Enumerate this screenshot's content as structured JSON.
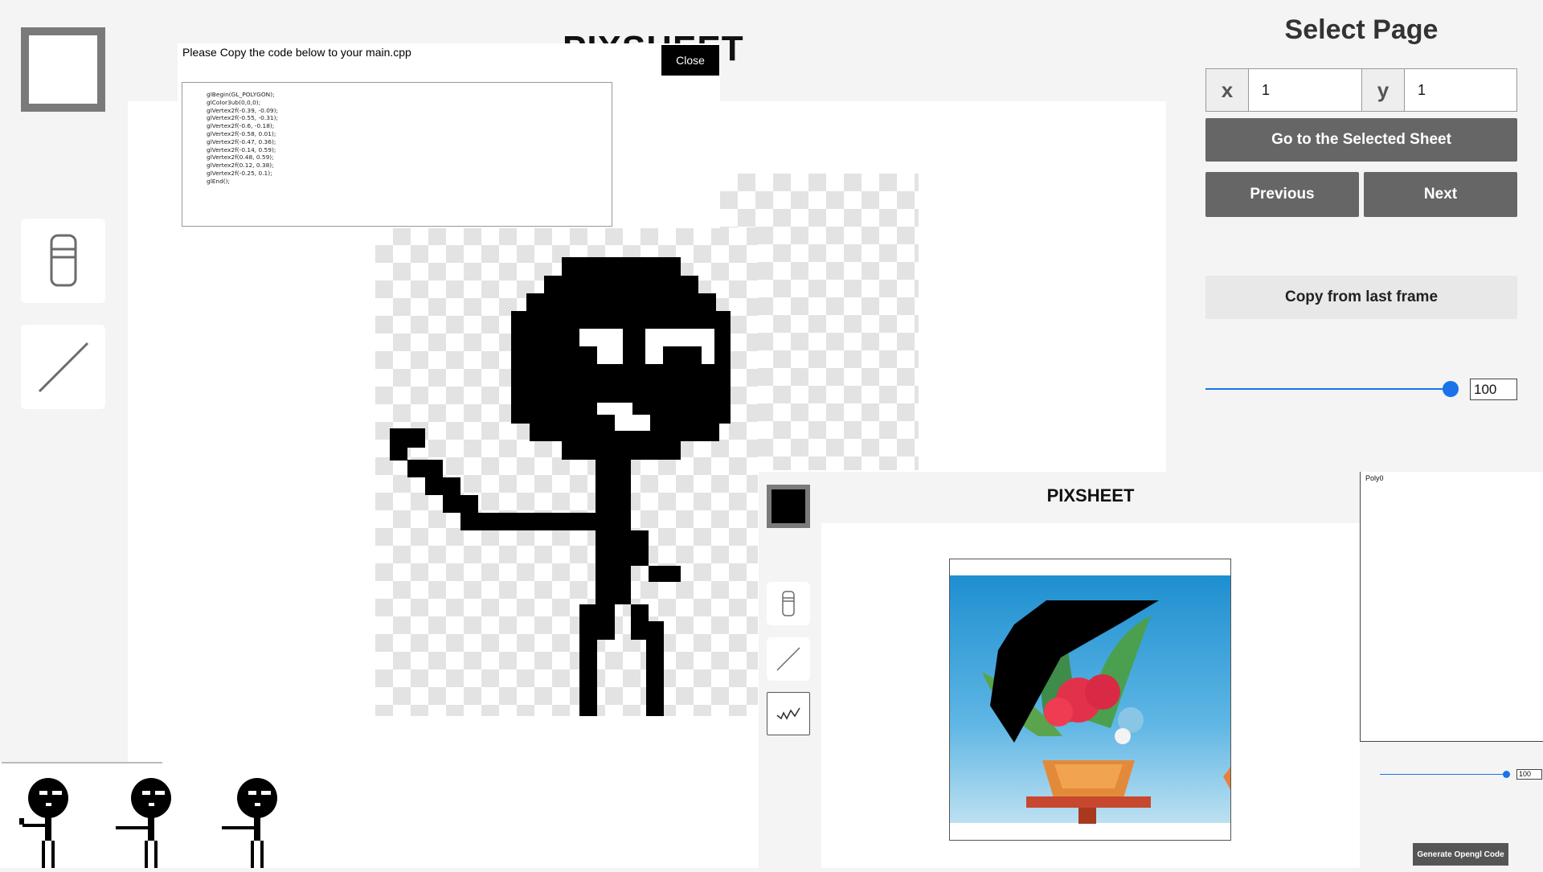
{
  "app": {
    "title": "PIXSHEET"
  },
  "code_dialog": {
    "instruction": "Please Copy the code below to your main.cpp",
    "close_label": "Close",
    "code": "glBegin(GL_POLYGON);\nglColor3ub(0,0,0);\nglVertex2f(-0.39, -0.09);\nglVertex2f(-0.55, -0.31);\nglVertex2f(-0.6, -0.18);\nglVertex2f(-0.58, 0.01);\nglVertex2f(-0.47, 0.36);\nglVertex2f(-0.14, 0.59);\nglVertex2f(0.48, 0.59);\nglVertex2f(0.12, 0.38);\nglVertex2f(-0.25, 0.1);\nglEnd();"
  },
  "right_panel": {
    "title": "Select Page",
    "x_label": "x",
    "x_value": "1",
    "y_label": "y",
    "y_value": "1",
    "go_label": "Go to the Selected Sheet",
    "previous_label": "Previous",
    "next_label": "Next",
    "copy_label": "Copy from last frame",
    "opacity_value": "100",
    "opacity_level": 1.0
  },
  "second_window": {
    "title": "PIXSHEET",
    "poly_label": "Poly0",
    "slider_value": "100",
    "generate_label": "Generate Opengl Code"
  },
  "colors": {
    "primary": "#000000",
    "accent": "#1a73e8",
    "button": "#666666"
  },
  "icons": {
    "color_swatch": "color-swatch-icon",
    "eraser": "eraser-icon",
    "line": "line-icon",
    "polygon": "polygon-tool-icon"
  }
}
